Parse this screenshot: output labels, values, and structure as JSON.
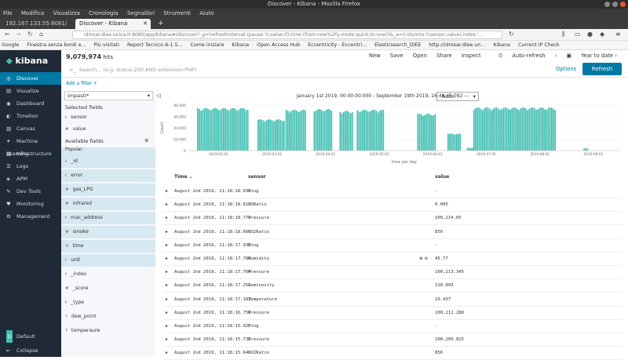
{
  "window_title": "Discover - Kibana - Mozilla Firefox",
  "menu": [
    "File",
    "Modifica",
    "Visualizza",
    "Cronologia",
    "Segnalibri",
    "Strumenti",
    "Aiuto"
  ],
  "tabs": [
    "192.167.133.55:8081/",
    "Discover - Kibana"
  ],
  "url": "idrosar.diee.unica.it:8080/app/kibana#/discover?_g=(refreshInterval:(pause:!t,value:0),time:(from:now%2Fy,mode:quick,to:now))&_a=(columns:!(sensor,value),index:'...",
  "bookmarks": [
    "Google",
    "Finestra senza bordi e...",
    "Più visitati",
    "Report Tecnico A-1.5...",
    "Come iniziare",
    "Kibana",
    "Open Access Hub",
    "Eccentricity - Eccentri...",
    "Elasticsearch_DIEE",
    "http://idrosar.diee.un...",
    "Kibana",
    "Current IP Check"
  ],
  "sidebar": {
    "logo": "kibana",
    "items": [
      "Discover",
      "Visualize",
      "Dashboard",
      "Timelion",
      "Canvas",
      "Machine Learning",
      "Infrastructure",
      "Logs",
      "APM",
      "Dev Tools",
      "Monitoring",
      "Management"
    ],
    "bottom": [
      "Default",
      "Collapse"
    ]
  },
  "hits": {
    "count": "9,079,974",
    "label": "hits"
  },
  "topnav": [
    "New",
    "Save",
    "Open",
    "Share",
    "Inspect",
    "Auto-refresh",
    "Year to date"
  ],
  "search_placeholder": "Search... (e.g. status:200 AND extension:PHP)",
  "options_label": "Options",
  "refresh_label": "Refresh",
  "add_filter": "Add a filter +",
  "index_pattern": "impasti*",
  "selected_header": "Selected fields",
  "selected_fields": [
    {
      "type": "t",
      "name": "sensor"
    },
    {
      "type": "#",
      "name": "value"
    }
  ],
  "available_header": "Available fields",
  "popular_label": "Popular",
  "available_fields": [
    {
      "type": "t",
      "name": "_id"
    },
    {
      "type": "t",
      "name": "error"
    },
    {
      "type": "#",
      "name": "gas_LPG"
    },
    {
      "type": "#",
      "name": "infrared"
    },
    {
      "type": "t",
      "name": "mac_address"
    },
    {
      "type": "#",
      "name": "smoke"
    },
    {
      "type": "⊙",
      "name": "time"
    },
    {
      "type": "t",
      "name": "unit"
    },
    {
      "type": "t",
      "name": "_index"
    },
    {
      "type": "#",
      "name": "_score"
    },
    {
      "type": "t",
      "name": "_type"
    },
    {
      "type": "?",
      "name": "dew_point"
    },
    {
      "type": "?",
      "name": "temperaure"
    }
  ],
  "histogram_range": "January 1st 2019, 00:00:00.000 - September 19th 2019, 16:46:45.092 —",
  "interval": "Auto",
  "chart_data": {
    "type": "bar",
    "ylabel": "Count",
    "xlabel": "time per day",
    "yticks": [
      0,
      20000,
      40000,
      60000,
      80000
    ],
    "ytick_labels": [
      "0",
      "20,000",
      "40,000",
      "60,000",
      "80,000"
    ],
    "xticks": [
      "2019-02-01",
      "2019-03-01",
      "2019-04-01",
      "2019-05-01",
      "2019-06-01",
      "2019-07-01",
      "2019-08-01",
      "2019-09-01"
    ],
    "segments": [
      {
        "from": 0.02,
        "to": 0.14,
        "value": 75000
      },
      {
        "from": 0.16,
        "to": 0.22,
        "value": 55000
      },
      {
        "from": 0.225,
        "to": 0.27,
        "value": 72000
      },
      {
        "from": 0.29,
        "to": 0.33,
        "value": 73000
      },
      {
        "from": 0.35,
        "to": 0.38,
        "value": 70000
      },
      {
        "from": 0.39,
        "to": 0.45,
        "value": 72000
      },
      {
        "from": 0.53,
        "to": 0.57,
        "value": 65000
      },
      {
        "from": 0.6,
        "to": 0.63,
        "value": 30000
      },
      {
        "from": 0.645,
        "to": 0.66,
        "value": 5000
      },
      {
        "from": 0.66,
        "to": 0.85,
        "value": 76000
      },
      {
        "from": 0.915,
        "to": 0.925,
        "value": 4000
      }
    ]
  },
  "table": {
    "columns": [
      "Time",
      "sensor",
      "value"
    ],
    "rows": [
      {
        "time": "August 2nd 2019, 11:18:18.933",
        "sensor": "Ping",
        "value": "-"
      },
      {
        "time": "August 2nd 2019, 11:18:18.813",
        "sensor": "CORatio",
        "value": "0.005"
      },
      {
        "time": "August 2nd 2019, 11:18:18.779",
        "sensor": "Pressure",
        "value": "100,214.05"
      },
      {
        "time": "August 2nd 2019, 11:18:18.666",
        "sensor": "CO2Ratio",
        "value": "856"
      },
      {
        "time": "August 2nd 2019, 11:18:17.930",
        "sensor": "Ping",
        "value": "-"
      },
      {
        "time": "August 2nd 2019, 11:18:17.780",
        "sensor": "Humidity",
        "value": "45.77"
      },
      {
        "time": "August 2nd 2019, 11:18:17.764",
        "sensor": "Pressure",
        "value": "100,213.345"
      },
      {
        "time": "August 2nd 2019, 11:18:17.259",
        "sensor": "Luminosity",
        "value": "318.893"
      },
      {
        "time": "August 2nd 2019, 11:18:17.183",
        "sensor": "Temperature",
        "value": "29.437"
      },
      {
        "time": "August 2nd 2019, 11:18:16.756",
        "sensor": "Pressure",
        "value": "100,212.288"
      },
      {
        "time": "August 2nd 2019, 11:18:15.927",
        "sensor": "Ping",
        "value": "-"
      },
      {
        "time": "August 2nd 2019, 11:18:15.731",
        "sensor": "Pressure",
        "value": "100,209.825"
      },
      {
        "time": "August 2nd 2019, 11:18:15.646",
        "sensor": "CO2Ratio",
        "value": "856"
      }
    ]
  }
}
